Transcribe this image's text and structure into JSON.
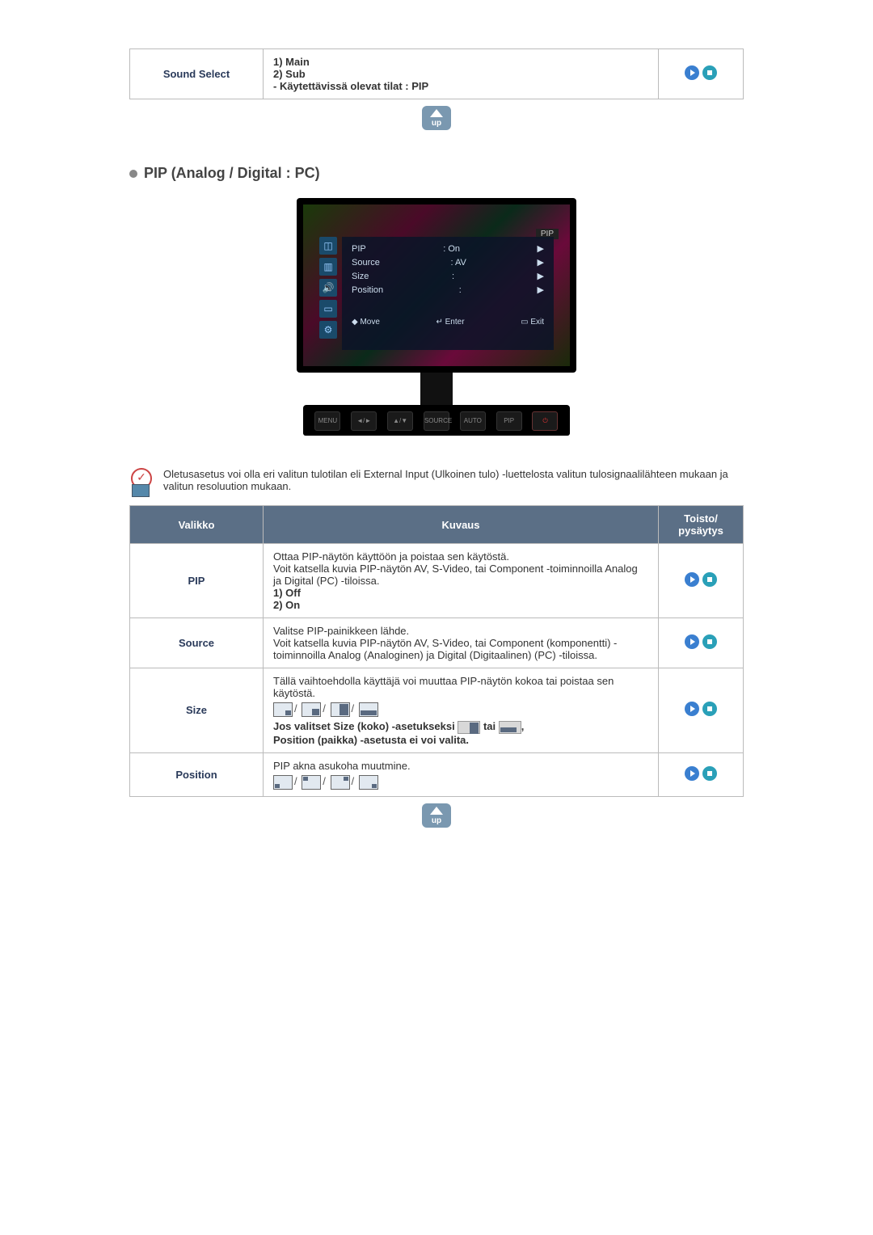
{
  "top_row": {
    "label": "Sound Select",
    "opt1": "1) Main",
    "opt2": "2) Sub",
    "modes": "- Käytettävissä olevat tilat : PIP"
  },
  "section_title": "PIP (Analog / Digital : PC)",
  "osd": {
    "pip_tag": "PIP",
    "rows": [
      {
        "label": "PIP",
        "value": ": On"
      },
      {
        "label": "Source",
        "value": ": AV"
      },
      {
        "label": "Size",
        "value": ":"
      },
      {
        "label": "Position",
        "value": ":"
      }
    ],
    "foot_move": "Move",
    "foot_enter": "Enter",
    "foot_exit": "Exit"
  },
  "monitor_buttons": [
    "MENU",
    "◄/►",
    "▲/▼",
    "SOURCE",
    "AUTO",
    "PIP",
    "⏻"
  ],
  "note_text": "Oletusasetus voi olla eri valitun tulotilan eli External Input (Ulkoinen tulo) -luettelosta valitun tulosignaalilähteen mukaan ja valitun resoluution mukaan.",
  "table": {
    "h1": "Valikko",
    "h2": "Kuvaus",
    "h3a": "Toisto/",
    "h3b": "pysäytys",
    "rows": {
      "pip": {
        "label": "PIP",
        "l1": "Ottaa PIP-näytön käyttöön ja poistaa sen käytöstä.",
        "l2": "Voit katsella kuvia PIP-näytön AV, S-Video, tai Component -toiminnoilla Analog ja Digital (PC) -tiloissa.",
        "opt1": "1) Off",
        "opt2": "2) On"
      },
      "source": {
        "label": "Source",
        "l1": "Valitse PIP-painikkeen lähde.",
        "l2": "Voit katsella kuvia PIP-näytön AV, S-Video, tai Component (komponentti) -toiminnoilla Analog (Analoginen) ja Digital (Digitaalinen) (PC) -tiloissa."
      },
      "size": {
        "label": "Size",
        "l1": "Tällä vaihtoehdolla käyttäjä voi muuttaa PIP-näytön kokoa tai poistaa sen käytöstä.",
        "note1": "Jos valitset Size (koko) -asetukseksi ",
        "note1b": " tai ",
        "note2": "Position (paikka) -asetusta ei voi valita."
      },
      "position": {
        "label": "Position",
        "l1": "PIP akna asukoha muutmine."
      }
    }
  }
}
